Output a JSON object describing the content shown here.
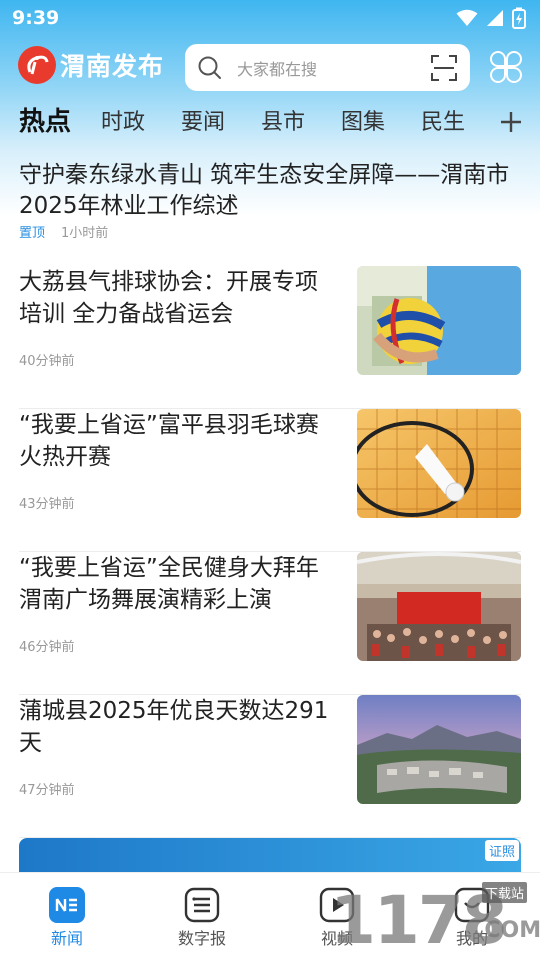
{
  "status_bar": {
    "time": "9:39"
  },
  "header": {
    "logo_text": "渭南发布",
    "search_placeholder": "大家都在搜"
  },
  "tabs": [
    "热点",
    "时政",
    "要闻",
    "县市",
    "图集",
    "民生"
  ],
  "top_article": {
    "title": "守护秦东绿水青山 筑牢生态安全屏障——渭南市2025年林业工作综述",
    "badge": "置顶",
    "time": "1小时前"
  },
  "news": [
    {
      "title": "大荔县气排球协会：开展专项培训 全力备战省运会",
      "time": "40分钟前",
      "thumb": "volleyball-photo"
    },
    {
      "title": "“我要上省运”富平县羽毛球赛火热开赛",
      "time": "43分钟前",
      "thumb": "badminton-photo"
    },
    {
      "title": "“我要上省运”全民健身大拜年渭南广场舞展演精彩上演",
      "time": "46分钟前",
      "thumb": "mall-dance-photo"
    },
    {
      "title": "蒲城县2025年优良天数达291天",
      "time": "47分钟前",
      "thumb": "city-landscape-photo"
    }
  ],
  "banner": {
    "badge": "证照"
  },
  "bottom_nav": [
    {
      "label": "新闻",
      "icon": "news-icon",
      "active": true
    },
    {
      "label": "数字报",
      "icon": "newspaper-icon",
      "active": false
    },
    {
      "label": "视频",
      "icon": "video-icon",
      "active": false
    },
    {
      "label": "我的",
      "icon": "profile-icon",
      "active": false
    }
  ],
  "watermark": {
    "big": "1178",
    "small": "下载站",
    "com": ".COM"
  },
  "colors": {
    "accent": "#1f8ae6",
    "header_blue": "#3fb6f0",
    "logo_red": "#e83b2e"
  }
}
